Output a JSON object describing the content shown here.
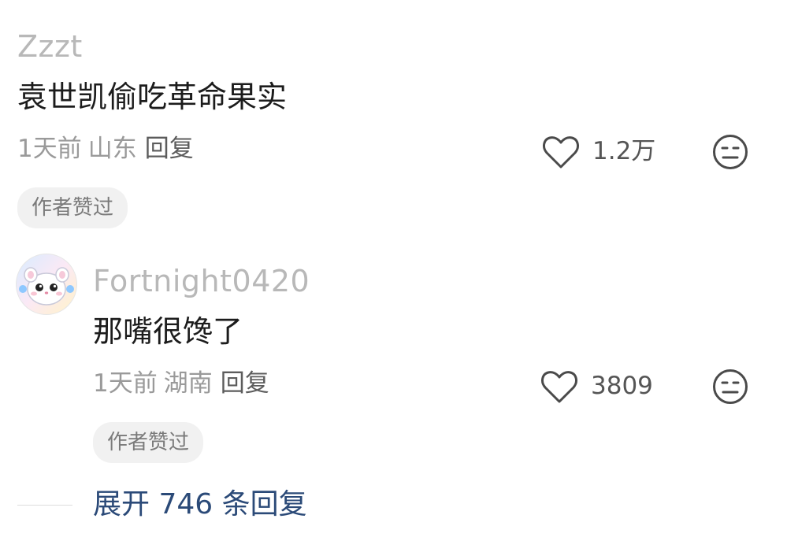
{
  "comments": [
    {
      "username": "Zzzt",
      "content": "袁世凯偷吃革命果实",
      "time": "1天前",
      "region": "山东",
      "reply_label": "回复",
      "likes": "1.2万",
      "badge": "作者赞过"
    },
    {
      "username": "Fortnight0420",
      "content": "那嘴很馋了",
      "time": "1天前",
      "region": "湖南",
      "reply_label": "回复",
      "likes": "3809",
      "badge": "作者赞过",
      "avatar": "hamster-avatar"
    }
  ],
  "expand_replies": "展开 746 条回复",
  "icons": {
    "like": "heart-outline-icon",
    "dislike": "neutral-face-icon"
  },
  "colors": {
    "username": "#b8b8b8",
    "meta": "#9a9a9a",
    "expand_link": "#2b4a78",
    "badge_bg": "#f1f1f1"
  }
}
